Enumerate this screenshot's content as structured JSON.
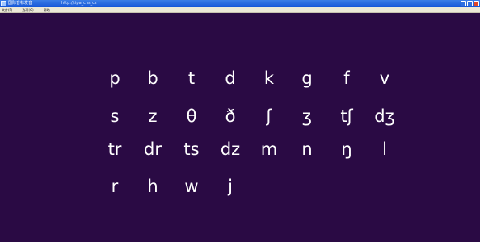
{
  "window": {
    "title": "国际音标发音",
    "path": "http://:ipa_cns_cs",
    "controls": [
      "minimize",
      "maximize",
      "close"
    ]
  },
  "menu": [
    "文件(F)",
    "选项(O)",
    "帮助"
  ],
  "corner_mark": "",
  "symbols": [
    [
      "p",
      "b",
      "t",
      "d",
      "k",
      "g",
      "f",
      "v"
    ],
    [
      "s",
      "z",
      "θ",
      "ð",
      "ʃ",
      "ʒ",
      "tʃ",
      "dʒ"
    ],
    [
      "tr",
      "dr",
      "ts",
      "dz",
      "m",
      "n",
      "ŋ",
      "l"
    ],
    [
      "r",
      "h",
      "w",
      "j"
    ]
  ],
  "colors": {
    "background": "#2a0a44",
    "text": "#ffffff",
    "accent": "#1020c8",
    "titlebar": "#1556d8"
  }
}
